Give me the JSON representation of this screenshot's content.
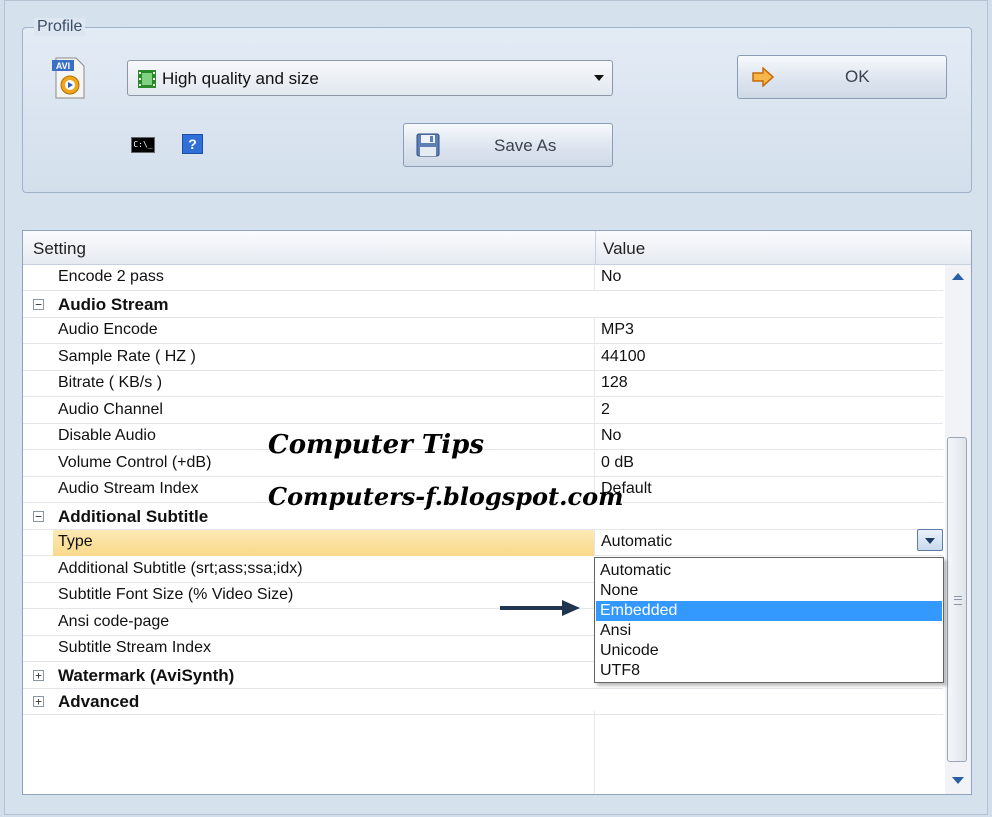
{
  "profile": {
    "legend": "Profile",
    "format_icon_label": "AVI",
    "selected_profile": "High quality and size",
    "ok_label": "OK",
    "save_as_label": "Save As",
    "cmd_icon_text": "C:\\_"
  },
  "grid": {
    "header_setting": "Setting",
    "header_value": "Value",
    "rows": [
      {
        "name": "Encode 2 pass",
        "value": "No"
      },
      {
        "name": "Audio Stream",
        "value": "",
        "category": true,
        "expander": "−"
      },
      {
        "name": "Audio Encode",
        "value": "MP3"
      },
      {
        "name": "Sample Rate ( HZ )",
        "value": "44100"
      },
      {
        "name": "Bitrate ( KB/s )",
        "value": "128"
      },
      {
        "name": "Audio Channel",
        "value": "2"
      },
      {
        "name": "Disable Audio",
        "value": "No"
      },
      {
        "name": "Volume Control (+dB)",
        "value": "0 dB"
      },
      {
        "name": "Audio Stream Index",
        "value": "Default"
      },
      {
        "name": "Additional Subtitle",
        "value": "",
        "category": true,
        "expander": "−"
      },
      {
        "name": "Type",
        "value": "Automatic"
      },
      {
        "name": "Additional Subtitle (srt;ass;ssa;idx)",
        "value": ""
      },
      {
        "name": "Subtitle Font Size (% Video Size)",
        "value": ""
      },
      {
        "name": "Ansi code-page",
        "value": ""
      },
      {
        "name": "Subtitle Stream Index",
        "value": ""
      },
      {
        "name": "Watermark (AviSynth)",
        "value": "",
        "category": true,
        "expander": "+"
      },
      {
        "name": "Advanced",
        "value": "",
        "category": true,
        "expander": "+"
      }
    ]
  },
  "dropdown": {
    "options": [
      "Automatic",
      "None",
      "Embedded",
      "Ansi",
      "Unicode",
      "UTF8"
    ],
    "selected": "Embedded"
  },
  "watermark": {
    "line1": "Computer Tips",
    "line2": "Computers-f.blogspot.com"
  },
  "icons": {
    "profile_format": "avi-file-icon",
    "profile_combo": "film-strip-icon",
    "ok": "orange-arrow-icon",
    "save": "floppy-disk-icon",
    "cmd": "command-prompt-icon",
    "help": "help-icon"
  },
  "colors": {
    "selected_row": "#f9d98a",
    "dropdown_highlight": "#3399ff",
    "scroll_arrow": "#2a5ea8"
  }
}
